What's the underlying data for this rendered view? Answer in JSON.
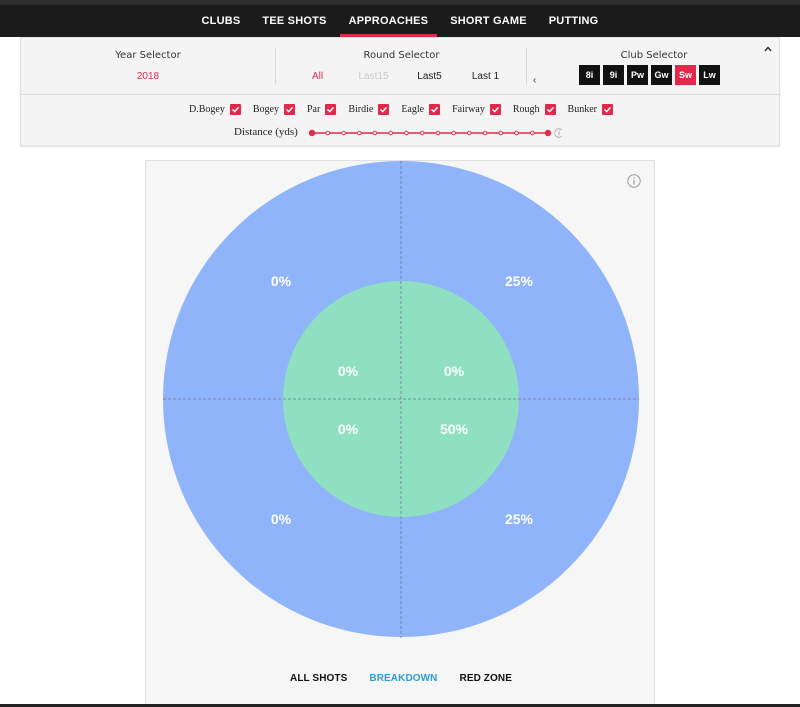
{
  "nav": {
    "tabs": [
      {
        "label": "CLUBS"
      },
      {
        "label": "TEE SHOTS"
      },
      {
        "label": "APPROACHES"
      },
      {
        "label": "SHORT GAME"
      },
      {
        "label": "PUTTING"
      }
    ],
    "active": "APPROACHES"
  },
  "filters": {
    "year_selector": {
      "title": "Year Selector",
      "value": "2018"
    },
    "round_selector": {
      "title": "Round Selector",
      "options": [
        {
          "label": "All",
          "state": "active"
        },
        {
          "label": "Last15",
          "state": "disabled"
        },
        {
          "label": "Last5",
          "state": "normal"
        },
        {
          "label": "Last 1",
          "state": "normal"
        }
      ]
    },
    "club_selector": {
      "title": "Club Selector",
      "prev_glyph": "‹",
      "clubs": [
        {
          "label": "8i",
          "selected": false
        },
        {
          "label": "9i",
          "selected": false
        },
        {
          "label": "Pw",
          "selected": false
        },
        {
          "label": "Gw",
          "selected": false
        },
        {
          "label": "Sw",
          "selected": true
        },
        {
          "label": "Lw",
          "selected": false
        }
      ]
    },
    "checkboxes": [
      {
        "label": "D.Bogey",
        "checked": true
      },
      {
        "label": "Bogey",
        "checked": true
      },
      {
        "label": "Par",
        "checked": true
      },
      {
        "label": "Birdie",
        "checked": true
      },
      {
        "label": "Eagle",
        "checked": true
      },
      {
        "label": "Fairway",
        "checked": true
      },
      {
        "label": "Rough",
        "checked": true
      },
      {
        "label": "Bunker",
        "checked": true
      }
    ],
    "distance": {
      "label": "Distance (yds)",
      "min_selected": 0,
      "max_selected": 1
    }
  },
  "target": {
    "outer_color": "#8fb4fa",
    "inner_color": "#8ee0c0",
    "outer": {
      "top_left": "0%",
      "top_right": "25%",
      "bottom_left": "0%",
      "bottom_right": "25%"
    },
    "inner": {
      "top_left": "0%",
      "top_right": "0%",
      "bottom_left": "0%",
      "bottom_right": "50%"
    }
  },
  "view_tabs": [
    {
      "label": "ALL SHOTS",
      "active": false
    },
    {
      "label": "BREAKDOWN",
      "active": true
    },
    {
      "label": "RED ZONE",
      "active": false
    }
  ],
  "colors": {
    "accent": "#e0294b",
    "link": "#2a9fd6"
  }
}
